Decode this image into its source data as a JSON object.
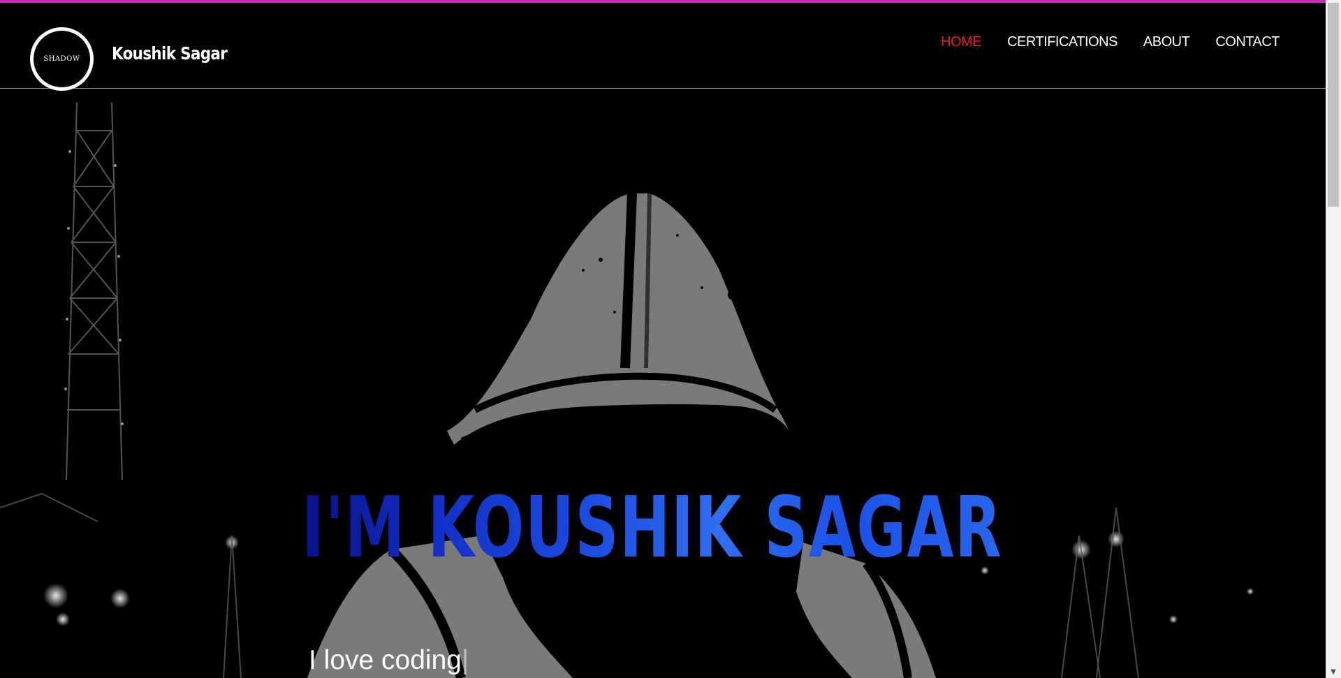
{
  "header": {
    "logo_text": "SHADOW",
    "brand": "Koushik Sagar",
    "nav": [
      {
        "label": "HOME",
        "active": true
      },
      {
        "label": "CERTIFICATIONS",
        "active": false
      },
      {
        "label": "ABOUT",
        "active": false
      },
      {
        "label": "CONTACT",
        "active": false
      }
    ]
  },
  "hero": {
    "title": "I'M KOUSHIK SAGAR",
    "subtitle": "I love coding",
    "cursor": "|"
  },
  "colors": {
    "top_strip": "#c52fb0",
    "nav_active": "#e3212b",
    "title_blue": "#1a4be0"
  },
  "scrollbar": {
    "down_arrow_icon": "chevron-down-icon"
  }
}
